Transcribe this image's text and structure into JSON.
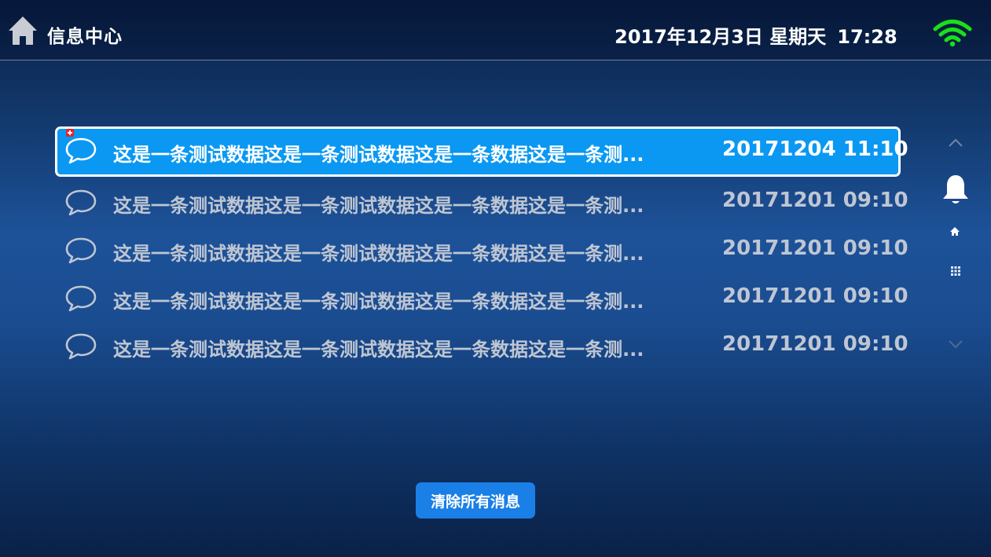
{
  "header": {
    "title": "信息中心",
    "date": "2017年12月3日 星期天",
    "time": "17:28",
    "home_icon": "home-icon",
    "wifi_icon": "wifi-icon",
    "wifi_color": "#19e01a"
  },
  "messages": [
    {
      "text": "这是一条测试数据这是一条测试数据这是一条数据这是一条测...",
      "time": "20171204 11:10",
      "selected": true,
      "is_new": true
    },
    {
      "text": "这是一条测试数据这是一条测试数据这是一条数据这是一条测...",
      "time": "20171201 09:10",
      "selected": false,
      "is_new": false
    },
    {
      "text": "这是一条测试数据这是一条测试数据这是一条数据这是一条测...",
      "time": "20171201 09:10",
      "selected": false,
      "is_new": false
    },
    {
      "text": "这是一条测试数据这是一条测试数据这是一条数据这是一条测...",
      "time": "20171201 09:10",
      "selected": false,
      "is_new": false
    },
    {
      "text": "这是一条测试数据这是一条测试数据这是一条数据这是一条测...",
      "time": "20171201 09:10",
      "selected": false,
      "is_new": false
    }
  ],
  "side_nav": {
    "icons": [
      "chevron-up-icon",
      "bell-icon",
      "home-icon",
      "grid-icon",
      "chevron-down-icon"
    ]
  },
  "footer": {
    "clear_label": "清除所有消息"
  },
  "colors": {
    "selected_row": "#0a98f2",
    "button": "#1a7fe6",
    "badge": "#e8222a",
    "inactive_text": "#bfc6d2"
  }
}
